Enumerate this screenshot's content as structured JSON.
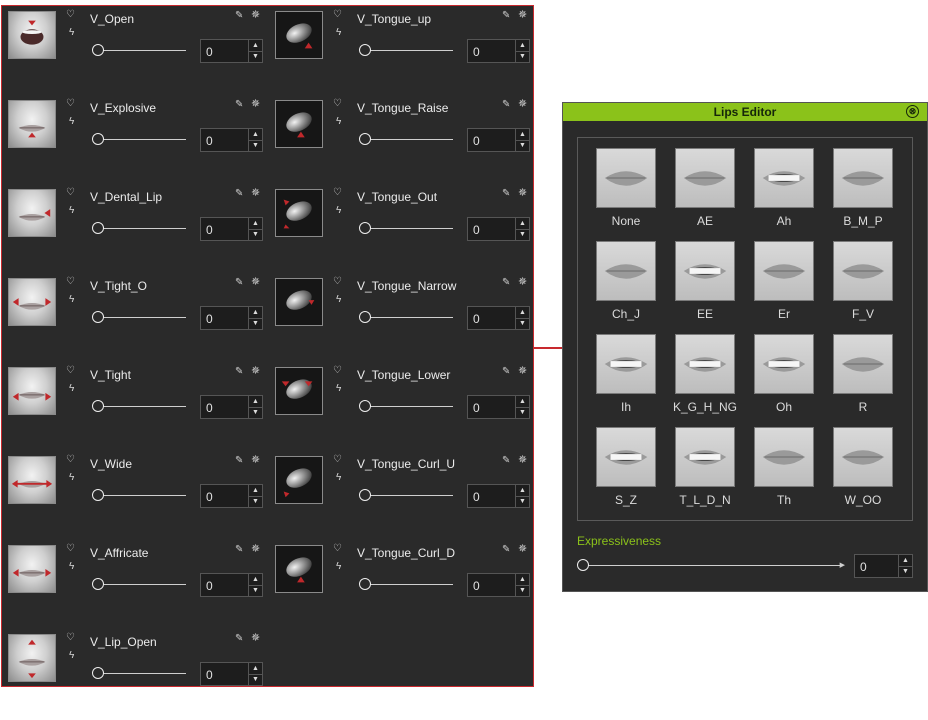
{
  "icons": {
    "heart": "♡",
    "bolt": "ϟ",
    "pencil": "✎",
    "gear": "✵",
    "up": "▲",
    "down": "▼"
  },
  "left_column": [
    {
      "name": "V_Open",
      "value": "0"
    },
    {
      "name": "V_Explosive",
      "value": "0"
    },
    {
      "name": "V_Dental_Lip",
      "value": "0"
    },
    {
      "name": "V_Tight_O",
      "value": "0"
    },
    {
      "name": "V_Tight",
      "value": "0"
    },
    {
      "name": "V_Wide",
      "value": "0"
    },
    {
      "name": "V_Affricate",
      "value": "0"
    },
    {
      "name": "V_Lip_Open",
      "value": "0"
    }
  ],
  "right_column": [
    {
      "name": "V_Tongue_up",
      "value": "0"
    },
    {
      "name": "V_Tongue_Raise",
      "value": "0"
    },
    {
      "name": "V_Tongue_Out",
      "value": "0"
    },
    {
      "name": "V_Tongue_Narrow",
      "value": "0"
    },
    {
      "name": "V_Tongue_Lower",
      "value": "0"
    },
    {
      "name": "V_Tongue_Curl_U",
      "value": "0"
    },
    {
      "name": "V_Tongue_Curl_D",
      "value": "0"
    }
  ],
  "lips_editor": {
    "title": "Lips Editor",
    "close_icon": "⊗",
    "visemes": [
      "None",
      "AE",
      "Ah",
      "B_M_P",
      "Ch_J",
      "EE",
      "Er",
      "F_V",
      "Ih",
      "K_G_H_NG",
      "Oh",
      "R",
      "S_Z",
      "T_L_D_N",
      "Th",
      "W_OO"
    ],
    "expressiveness_label": "Expressiveness",
    "expressiveness_value": "0",
    "slider_end_icon": "▶"
  },
  "colors": {
    "panel": "#2a2a2a",
    "accent_red": "#c8292e",
    "accent_green": "#8bc21a"
  }
}
